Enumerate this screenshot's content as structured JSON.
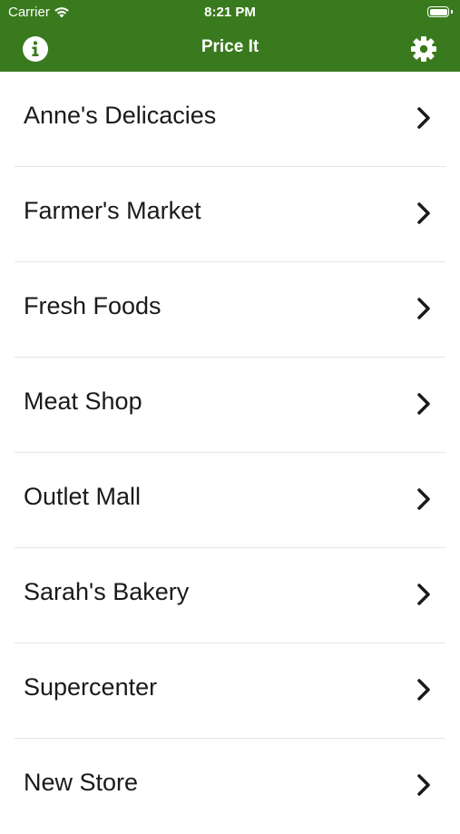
{
  "status_bar": {
    "carrier": "Carrier",
    "time": "8:21 PM"
  },
  "nav": {
    "title": "Price It",
    "left_icon": "info-icon",
    "right_icon": "gear-icon",
    "background": "#3a7a1e"
  },
  "stores": [
    {
      "label": "Anne's Delicacies"
    },
    {
      "label": "Farmer's Market"
    },
    {
      "label": "Fresh Foods"
    },
    {
      "label": "Meat Shop"
    },
    {
      "label": "Outlet Mall"
    },
    {
      "label": "Sarah's Bakery"
    },
    {
      "label": "Supercenter"
    },
    {
      "label": "New Store"
    }
  ]
}
